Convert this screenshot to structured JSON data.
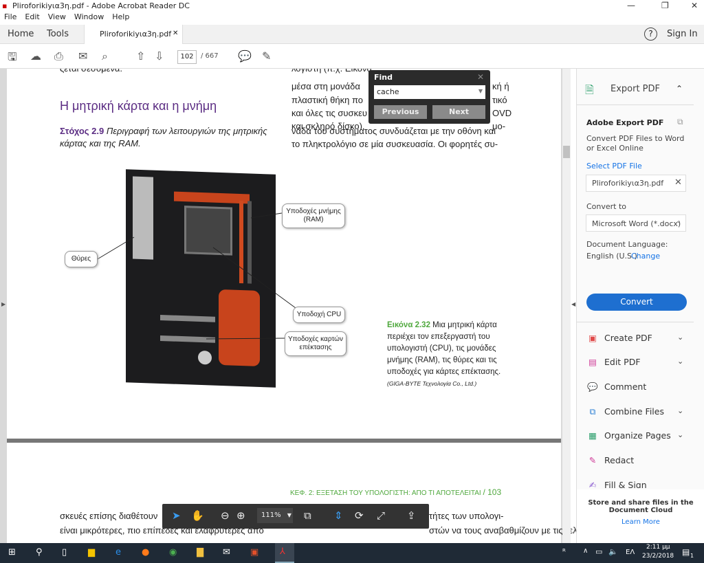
{
  "window": {
    "title": "Pliroforikiyια3η.pdf - Adobe Acrobat Reader DC",
    "minimize": "—",
    "restore": "❐",
    "close": "✕"
  },
  "menu": [
    "File",
    "Edit",
    "View",
    "Window",
    "Help"
  ],
  "tabs": {
    "home": "Home",
    "tools": "Tools",
    "doc": "Pliroforikiyια3η.pdf",
    "doc_close": "✕",
    "help": "?",
    "signin": "Sign In"
  },
  "toolbar": {
    "page_current": "102",
    "page_total": "/ 667"
  },
  "find": {
    "title": "Find",
    "value": "cache",
    "previous": "Previous",
    "next": "Next",
    "close": "✕"
  },
  "document": {
    "top_left": "ςεται σεσομενα.",
    "top_right": "λογιστή (π.χ. Εικόνα",
    "heading": "Η μητρική κάρτα και η μνήμη",
    "goal_label": "Στόχος 2.9",
    "goal_text1": "Περιγραφή των λειτουργιών της μητρικής",
    "goal_text2": "κάρτας και της RAM.",
    "right_lines": [
      "μέσα στη μονάδα",
      "πλαστική θήκη πο",
      "και όλες τις συσκευ",
      "και σκληρό δίσκο).",
      "νάδα του συστήματος συνδυάζεται με την οθόνη και",
      "το πληκτρολόγιο σε μία συσκευασία. Οι φορητές συ-"
    ],
    "right_tails": [
      "κή ή",
      "τικό",
      "OVD",
      "μο-"
    ],
    "callouts": {
      "ram": "Υποδοχές μνήμης (RAM)",
      "ports": "Θύρες",
      "cpu": "Υποδοχή CPU",
      "expansion": "Υποδοχές καρτών επέκτασης"
    },
    "caption_label": "Εικόνα 2.32",
    "caption_lines": [
      "Μια μητρική κάρτα",
      "περιέχει τον επεξεργαστή του",
      "υπολογιστή (CPU), τις μονάδες",
      "μνήμης (RAM), τις θύρες και τις",
      "υποδοχές για κάρτες επέκτασης."
    ],
    "credit": "(GIGA-BYTE Τεχνολογία Co., Ltd.)",
    "running_head": "ΚΕΦ. 2: ΕΞΕΤΑΣΗ ΤΟΥ ΥΠΟΛΟΓΙΣΤΗ: ΑΠΟ ΤΙ ΑΠΟΤΕΛΕΙΤΑΙ",
    "page_number": "/  103",
    "bottom_left": [
      "σκευές επίσης διαθέτουν",
      "είναι μικρότερες, πιο επίπεδες και ελαφρύτερες από"
    ],
    "bottom_right": [
      "τήτες των υπολογι-",
      "στών να τους αναβαθμίζουν με τις τελευταίες κάρτες"
    ]
  },
  "zoom": {
    "level": "111%"
  },
  "right_pane": {
    "export_title": "Export PDF",
    "section_title": "Adobe Export PDF",
    "desc1": "Convert PDF Files to Word",
    "desc2": "or Excel Online",
    "select_label": "Select PDF File",
    "file": "Pliroforikiyια3η.pdf",
    "convert_to": "Convert to",
    "format": "Microsoft Word (*.docx)",
    "lang_label": "Document Language:",
    "lang": "English (U.S.)",
    "change": "Change",
    "convert_btn": "Convert",
    "tools": [
      "Create PDF",
      "Edit PDF",
      "Comment",
      "Combine Files",
      "Organize Pages",
      "Redact",
      "Fill & Sign"
    ],
    "cloud1": "Store and share files in the",
    "cloud2": "Document Cloud",
    "learn_more": "Learn More"
  },
  "taskbar": {
    "lang": "ΕΛ",
    "time": "2:11 μμ",
    "date": "23/2/2018",
    "notifications": "1"
  },
  "colors": {
    "accent": "#1473e6",
    "heading": "#5b2c83",
    "caption": "#4fa83d",
    "convert": "#1e6fd0"
  }
}
